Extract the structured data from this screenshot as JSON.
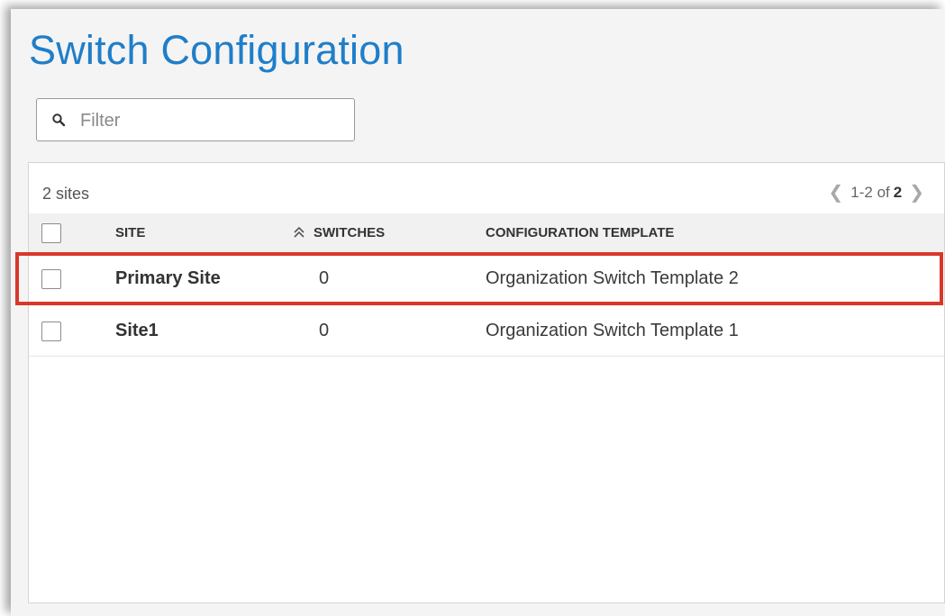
{
  "page": {
    "title": "Switch Configuration"
  },
  "filter": {
    "placeholder": "Filter",
    "value": ""
  },
  "table": {
    "count_label": "2 sites",
    "pager": {
      "range": "1-2 of",
      "total": "2"
    },
    "columns": [
      "SITE",
      "SWITCHES",
      "CONFIGURATION TEMPLATE"
    ],
    "rows": [
      {
        "site": "Primary Site",
        "switches": "0",
        "template": "Organization Switch Template 2",
        "highlighted": true
      },
      {
        "site": "Site1",
        "switches": "0",
        "template": "Organization Switch Template 1",
        "highlighted": false
      }
    ]
  },
  "colors": {
    "title": "#1f7ec9",
    "highlight_border": "#d9372a"
  },
  "icons": {
    "filter": "search-icon",
    "sort": "double-chevron-up-icon",
    "pager_prev": "chevron-left-icon",
    "pager_next": "chevron-right-icon"
  }
}
